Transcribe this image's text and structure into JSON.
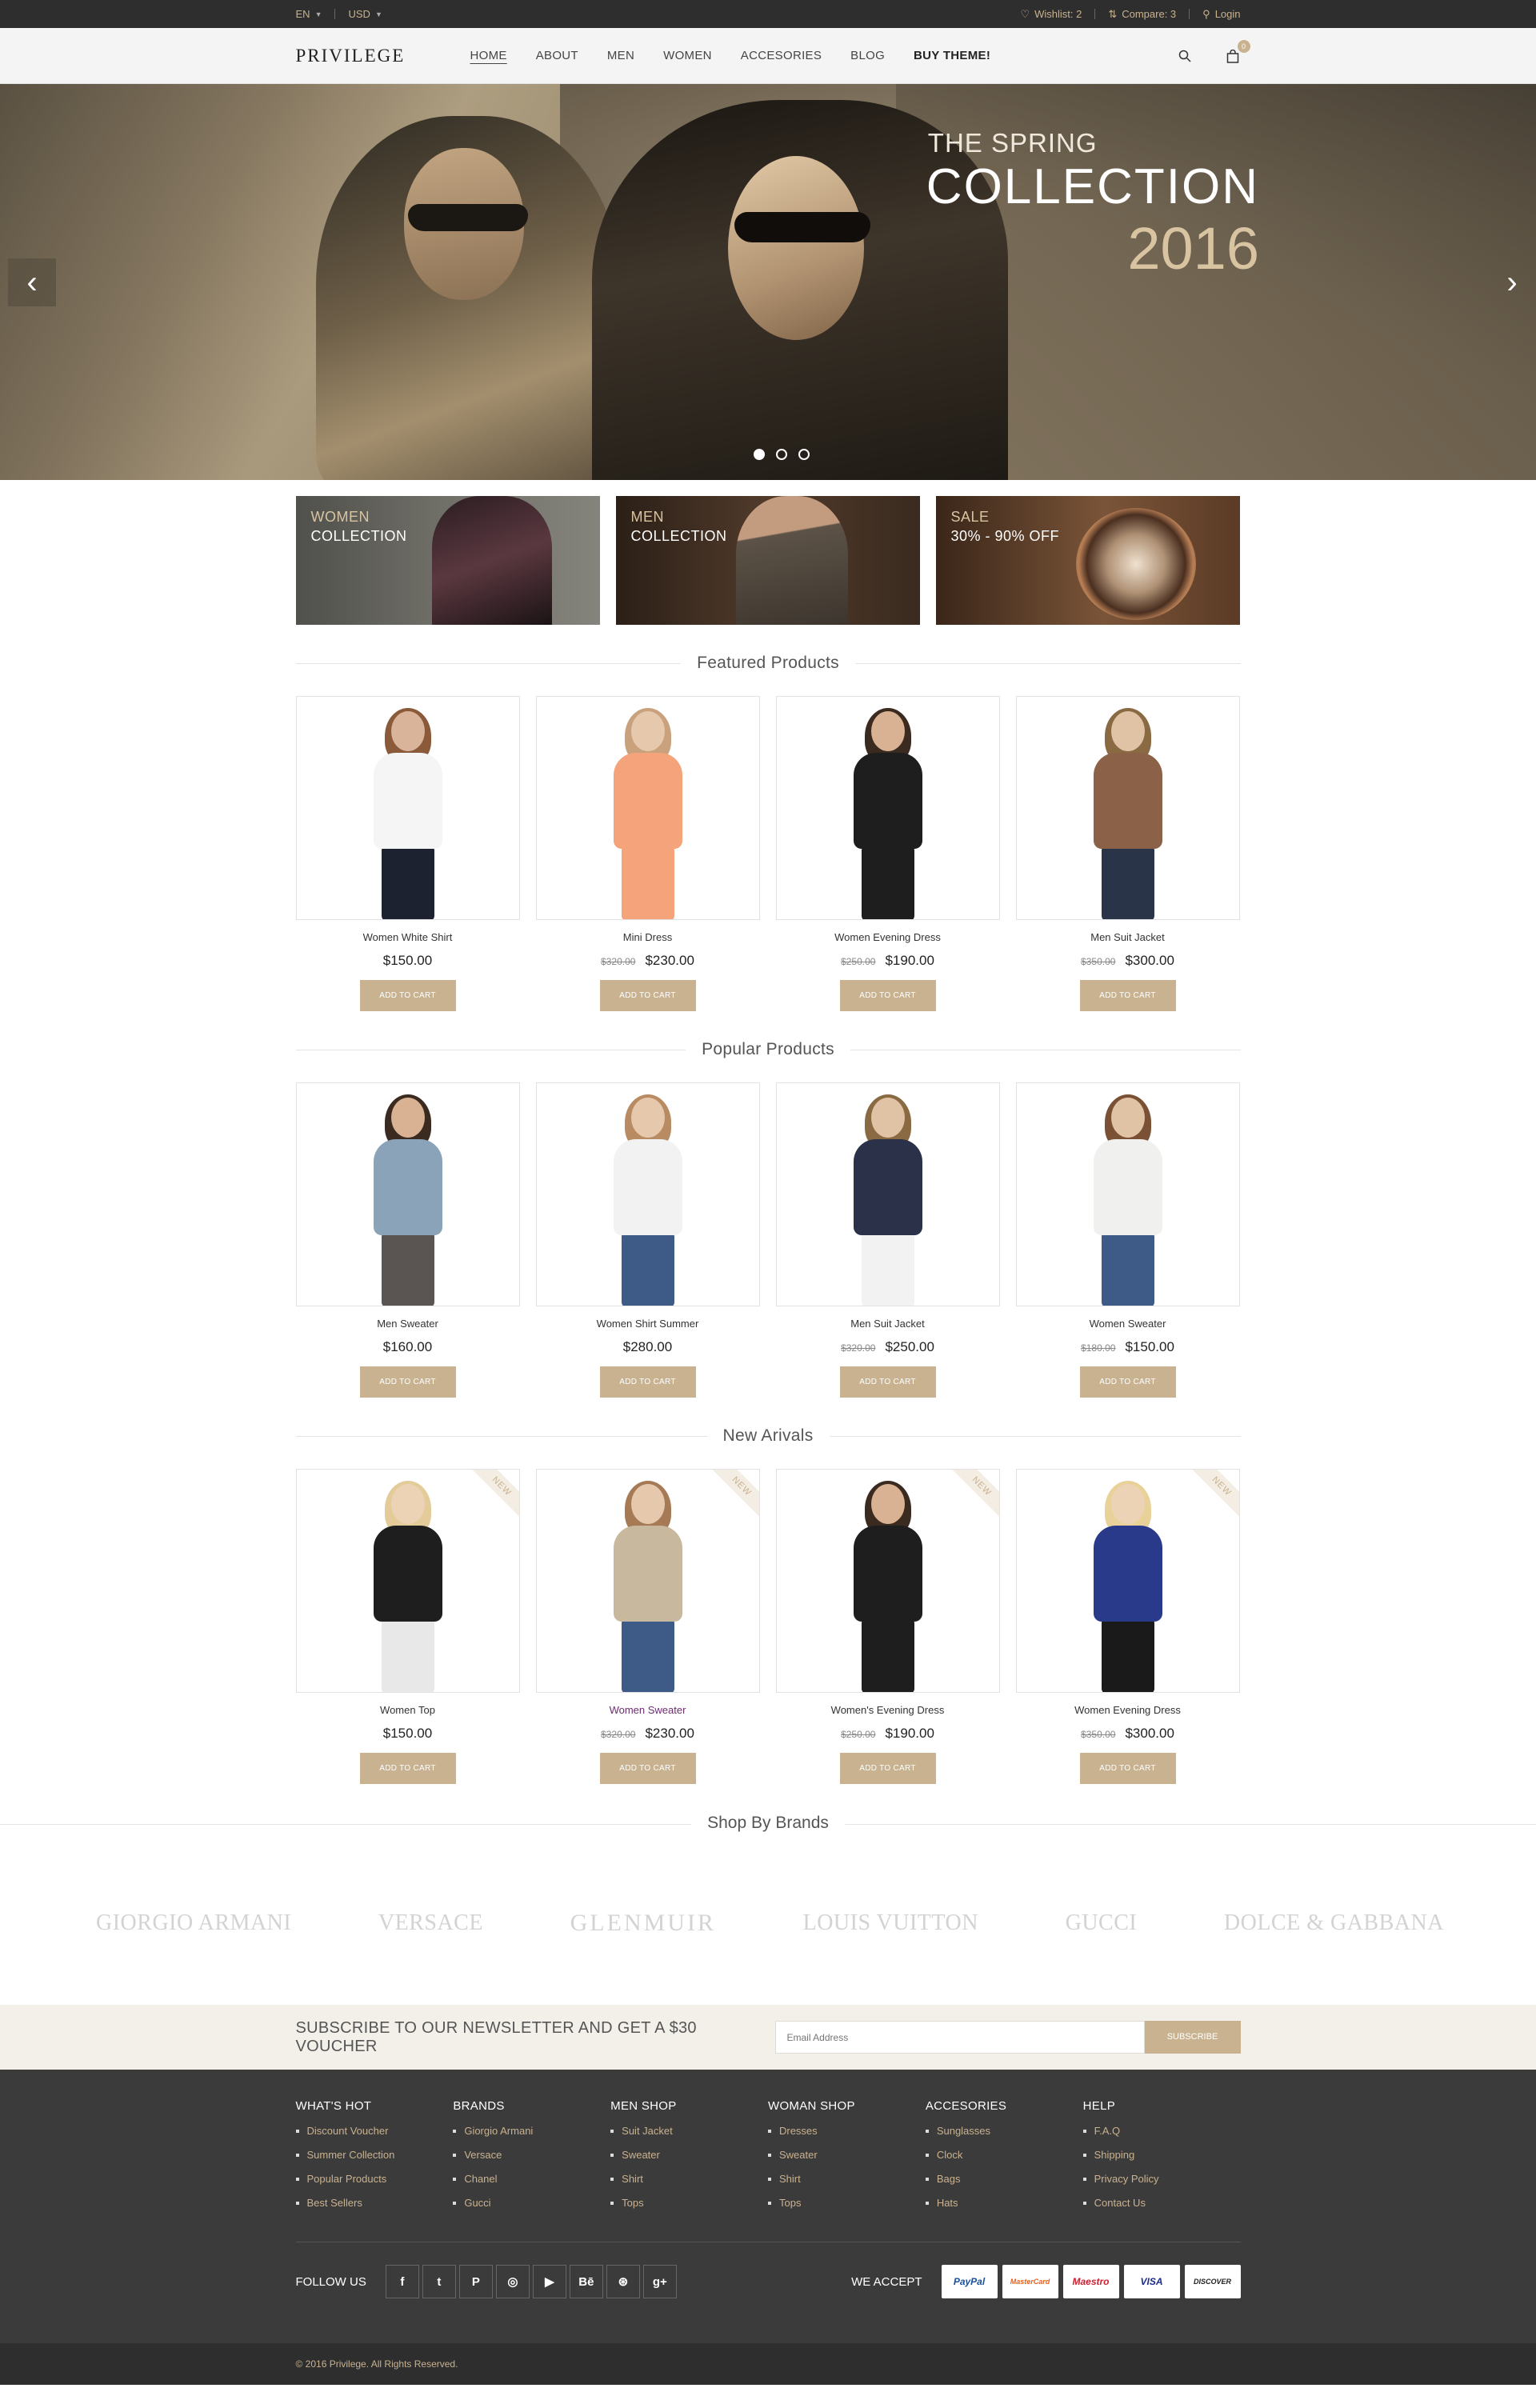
{
  "topbar": {
    "language": "EN",
    "currency": "USD",
    "wishlist": "Wishlist: 2",
    "compare": "Compare: 3",
    "login": "Login"
  },
  "header": {
    "logo": "PRIVILEGE",
    "nav": [
      "HOME",
      "ABOUT",
      "MEN",
      "WOMEN",
      "ACCESORIES",
      "BLOG",
      "BUY THEME!"
    ],
    "cart_count": "0"
  },
  "hero": {
    "line1": "THE SPRING",
    "line2": "COLLECTION",
    "line3": "2016",
    "slides": 3,
    "active_slide": 1
  },
  "banners": [
    {
      "label": "WOMEN",
      "sub": "COLLECTION"
    },
    {
      "label": "MEN",
      "sub": "COLLECTION"
    },
    {
      "label": "SALE",
      "sub": "30% - 90% OFF"
    }
  ],
  "sections": [
    {
      "title": "Featured Products",
      "products": [
        {
          "name": "Women White Shirt",
          "old": "",
          "price": "$150.00"
        },
        {
          "name": "Mini Dress",
          "old": "$320.00",
          "price": "$230.00"
        },
        {
          "name": "Women Evening Dress",
          "old": "$250.00",
          "price": "$190.00"
        },
        {
          "name": "Men Suit Jacket",
          "old": "$350.00",
          "price": "$300.00"
        }
      ]
    },
    {
      "title": "Popular Products",
      "products": [
        {
          "name": "Men Sweater",
          "old": "",
          "price": "$160.00"
        },
        {
          "name": "Women Shirt Summer",
          "old": "",
          "price": "$280.00"
        },
        {
          "name": "Men Suit Jacket",
          "old": "$320.00",
          "price": "$250.00"
        },
        {
          "name": "Women Sweater",
          "old": "$180.00",
          "price": "$150.00"
        }
      ]
    },
    {
      "title": "New Arivals",
      "products": [
        {
          "name": "Women Top",
          "old": "",
          "price": "$150.00"
        },
        {
          "name": "Women Sweater",
          "old": "$320.00",
          "price": "$230.00"
        },
        {
          "name": "Women's Evening Dress",
          "old": "$250.00",
          "price": "$190.00"
        },
        {
          "name": "Women Evening Dress",
          "old": "$350.00",
          "price": "$300.00"
        }
      ]
    }
  ],
  "add_to_cart": "ADD TO CART",
  "new_tag": "NEW",
  "brands": {
    "title": "Shop By Brands",
    "items": [
      "GIORGIO ARMANI",
      "VERSACE",
      "GLENMUIR",
      "LOUIS VUITTON",
      "GUCCI",
      "DOLCE & GABBANA"
    ]
  },
  "newsletter": {
    "text": "SUBSCRIBE TO OUR NEWSLETTER AND GET A $30 VOUCHER",
    "placeholder": "Email Address",
    "button": "SUBSCRIBE"
  },
  "footer": {
    "columns": [
      {
        "title": "WHAT'S HOT",
        "links": [
          "Discount Voucher",
          "Summer Collection",
          "Popular Products",
          "Best Sellers"
        ]
      },
      {
        "title": "BRANDS",
        "links": [
          "Giorgio Armani",
          "Versace",
          "Chanel",
          "Gucci"
        ]
      },
      {
        "title": "MEN SHOP",
        "links": [
          "Suit Jacket",
          "Sweater",
          "Shirt",
          "Tops"
        ]
      },
      {
        "title": "WOMAN SHOP",
        "links": [
          "Dresses",
          "Sweater",
          "Shirt",
          "Tops"
        ]
      },
      {
        "title": "ACCESORIES",
        "links": [
          "Sunglasses",
          "Clock",
          "Bags",
          "Hats"
        ]
      },
      {
        "title": "HELP",
        "links": [
          "F.A.Q",
          "Shipping",
          "Privacy Policy",
          "Contact Us"
        ]
      }
    ],
    "follow_label": "FOLLOW US",
    "socials": [
      {
        "icon": "facebook-icon",
        "glyph": "f"
      },
      {
        "icon": "twitter-icon",
        "glyph": "t"
      },
      {
        "icon": "pinterest-icon",
        "glyph": "P"
      },
      {
        "icon": "instagram-icon",
        "glyph": "◎"
      },
      {
        "icon": "youtube-icon",
        "glyph": "▶"
      },
      {
        "icon": "behance-icon",
        "glyph": "Bē"
      },
      {
        "icon": "dribbble-icon",
        "glyph": "⊛"
      },
      {
        "icon": "googleplus-icon",
        "glyph": "g+"
      }
    ],
    "accept_label": "WE ACCEPT",
    "cards": [
      {
        "name": "PayPal",
        "color": "#1b4f9c"
      },
      {
        "name": "MasterCard",
        "color": "#e8601c"
      },
      {
        "name": "Maestro",
        "color": "#cc1f2f"
      },
      {
        "name": "VISA",
        "color": "#1a2b8b"
      },
      {
        "name": "DISCOVER",
        "color": "#222222"
      }
    ],
    "copyright": "© 2016 Privilege. All Rights Reserved."
  },
  "colors": {
    "accent": "#c9b28f",
    "dark": "#2e2e2e",
    "footer": "#3c3b3b"
  }
}
